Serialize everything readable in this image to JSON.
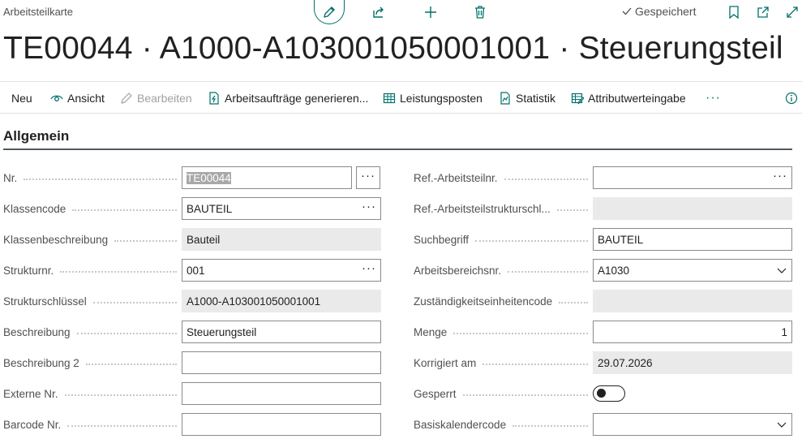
{
  "header": {
    "page_type": "Arbeitsteilkarte",
    "saved_label": "Gespeichert",
    "title": "TE00044 · A1000-A103001050001001 · Steuerungsteil"
  },
  "actions": {
    "new": "Neu",
    "view": "Ansicht",
    "edit": "Bearbeiten",
    "generate": "Arbeitsaufträge generieren...",
    "entries": "Leistungsposten",
    "statistics": "Statistik",
    "attributes": "Attributwerteingabe",
    "more": "···"
  },
  "section": {
    "title": "Allgemein"
  },
  "left": {
    "nr": {
      "label": "Nr.",
      "value": "TE00044"
    },
    "klassencode": {
      "label": "Klassencode",
      "value": "BAUTEIL"
    },
    "klassenbeschreibung": {
      "label": "Klassenbeschreibung",
      "value": "Bauteil"
    },
    "strukturnr": {
      "label": "Strukturnr.",
      "value": "001"
    },
    "strukturschluessel": {
      "label": "Strukturschlüssel",
      "value": "A1000-A103001050001001"
    },
    "beschreibung": {
      "label": "Beschreibung",
      "value": "Steuerungsteil"
    },
    "beschreibung2": {
      "label": "Beschreibung 2",
      "value": ""
    },
    "externe_nr": {
      "label": "Externe Nr.",
      "value": ""
    },
    "barcode_nr": {
      "label": "Barcode Nr.",
      "value": ""
    }
  },
  "right": {
    "ref_arbeitsteilnr": {
      "label": "Ref.-Arbeitsteilnr.",
      "value": ""
    },
    "ref_strukturschl": {
      "label": "Ref.-Arbeitsteilstrukturschl...",
      "value": ""
    },
    "suchbegriff": {
      "label": "Suchbegriff",
      "value": "BAUTEIL"
    },
    "arbeitsbereichsnr": {
      "label": "Arbeitsbereichsnr.",
      "value": "A1030"
    },
    "zustaendigkeit": {
      "label": "Zuständigkeitseinheitencode",
      "value": ""
    },
    "menge": {
      "label": "Menge",
      "value": "1"
    },
    "korrigiert_am": {
      "label": "Korrigiert am",
      "value": "29.07.2026"
    },
    "gesperrt": {
      "label": "Gesperrt",
      "value": false
    },
    "basiskalendercode": {
      "label": "Basiskalendercode",
      "value": ""
    }
  },
  "ellipsis": "···",
  "colors": {
    "accent": "#00706a",
    "label": "#505050",
    "readonly_bg": "#eaeaea"
  },
  "icons": [
    "pencil-icon",
    "share-icon",
    "plus-icon",
    "trash-icon",
    "check-icon",
    "bookmark-icon",
    "open-new-window-icon",
    "expand-icon",
    "eye-icon",
    "document-bolt-icon",
    "table-icon",
    "chart-icon",
    "attribute-icon",
    "info-icon",
    "chevron-down-icon"
  ]
}
